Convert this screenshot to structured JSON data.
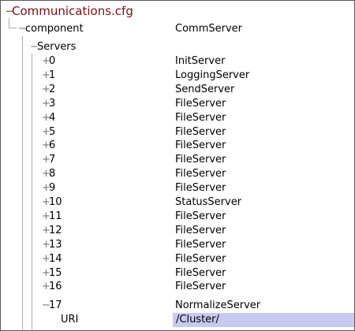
{
  "tree": {
    "root": {
      "sign": "−",
      "label": "Communications.cfg"
    },
    "component": {
      "sign": "−",
      "label": "component",
      "value": "CommServer"
    },
    "servers": {
      "sign": "−",
      "label": "Servers"
    },
    "items": [
      {
        "sign": "+",
        "index": "0",
        "value": "InitServer"
      },
      {
        "sign": "+",
        "index": "1",
        "value": "LoggingServer"
      },
      {
        "sign": "+",
        "index": "2",
        "value": "SendServer"
      },
      {
        "sign": "+",
        "index": "3",
        "value": "FileServer"
      },
      {
        "sign": "+",
        "index": "4",
        "value": "FileServer"
      },
      {
        "sign": "+",
        "index": "5",
        "value": "FileServer"
      },
      {
        "sign": "+",
        "index": "6",
        "value": "FileServer"
      },
      {
        "sign": "+",
        "index": "7",
        "value": "FileServer"
      },
      {
        "sign": "+",
        "index": "8",
        "value": "FileServer"
      },
      {
        "sign": "+",
        "index": "9",
        "value": "FileServer"
      },
      {
        "sign": "+",
        "index": "10",
        "value": "StatusServer"
      },
      {
        "sign": "+",
        "index": "11",
        "value": "FileServer"
      },
      {
        "sign": "+",
        "index": "12",
        "value": "FileServer"
      },
      {
        "sign": "+",
        "index": "13",
        "value": "FileServer"
      },
      {
        "sign": "+",
        "index": "14",
        "value": "FileServer"
      },
      {
        "sign": "+",
        "index": "15",
        "value": "FileServer"
      },
      {
        "sign": "+",
        "index": "16",
        "value": "FileServer"
      },
      {
        "sign": "−",
        "index": "17",
        "value": "NormalizeServer"
      }
    ],
    "uri": {
      "label": "URI",
      "value": "/Cluster/"
    }
  },
  "colors": {
    "root_text": "#7a1010",
    "selection": "#c8c8f0",
    "tree_lines": "#aaaaaa"
  }
}
